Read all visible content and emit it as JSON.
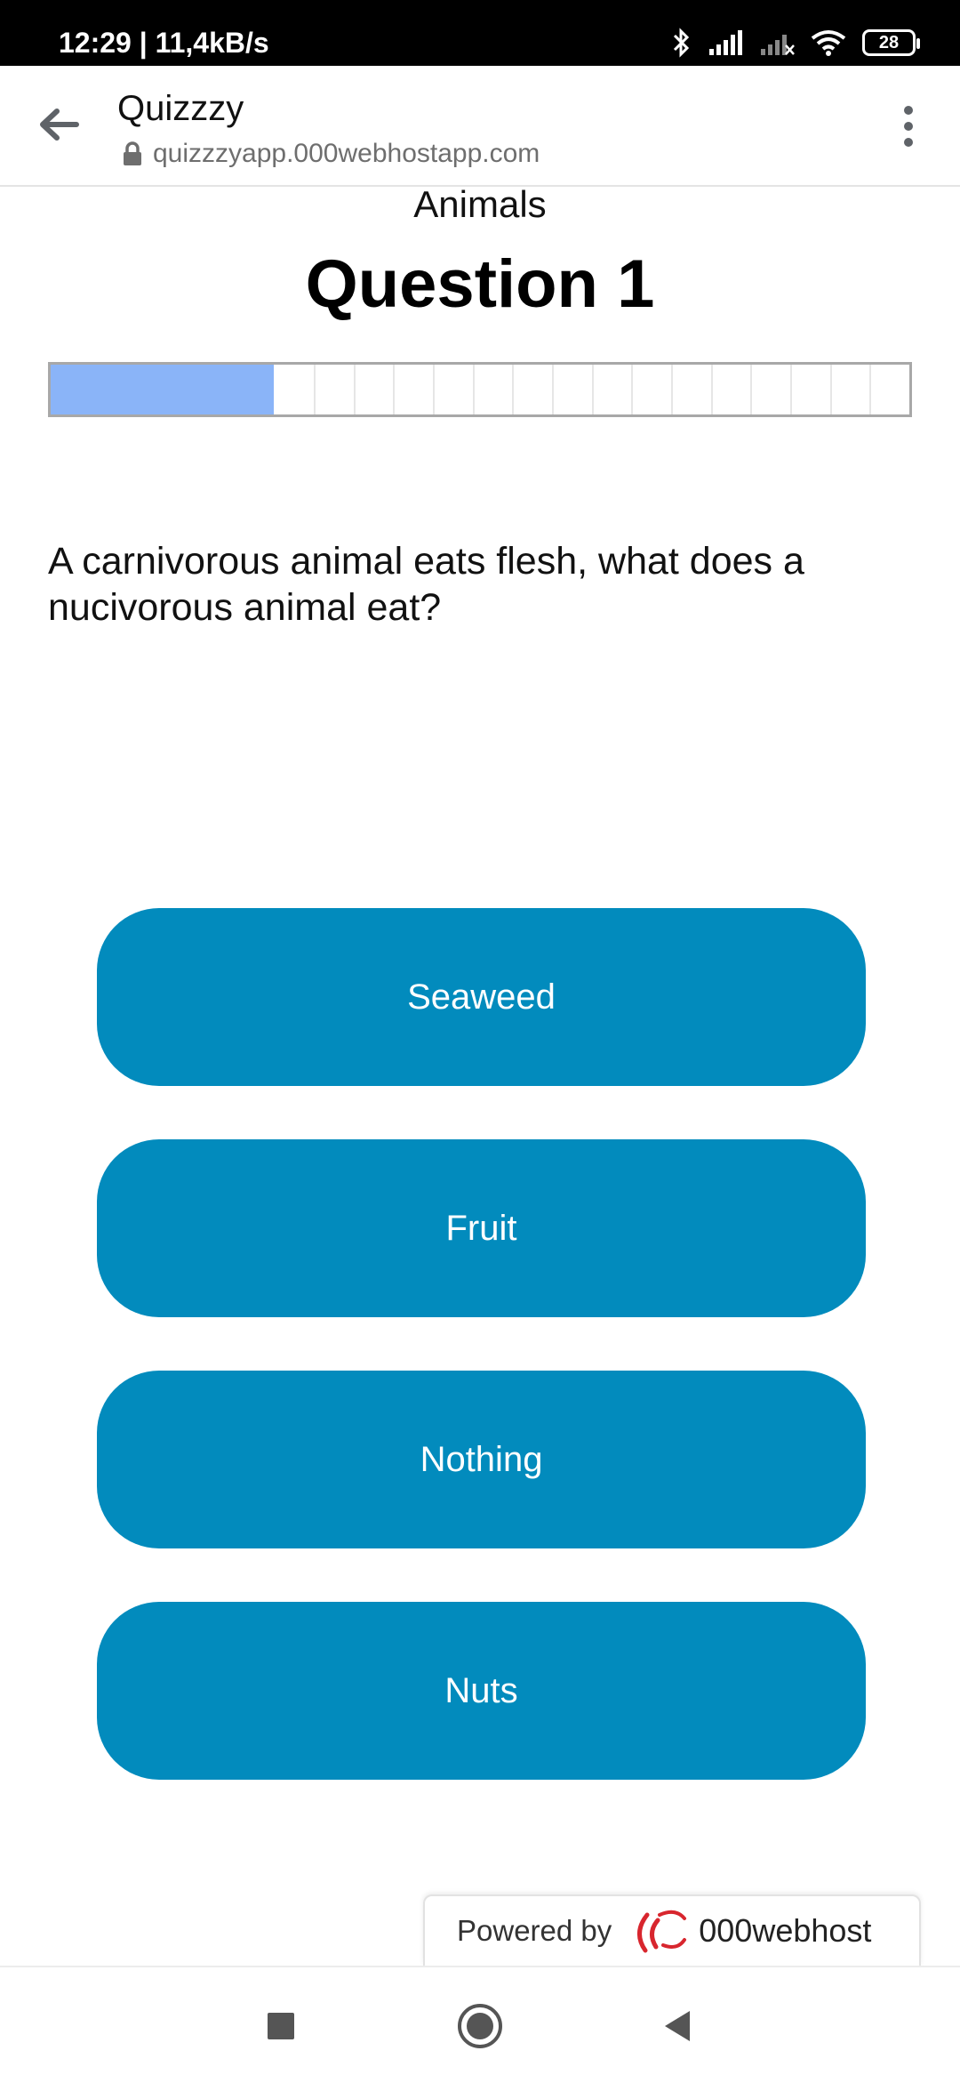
{
  "status_bar": {
    "time": "12:29 | 11,4kB/s",
    "battery": "28"
  },
  "browser": {
    "title": "Quizzzy",
    "url": "quizzzyapp.000webhostapp.com"
  },
  "quiz": {
    "category": "Animals",
    "question_title": "Question 1",
    "progress": {
      "fraction": 0.26,
      "segments": 16
    },
    "question_text": "A carnivorous animal eats flesh, what does a nucivorous animal eat?",
    "answers": [
      "Seaweed",
      "Fruit",
      "Nothing",
      "Nuts"
    ]
  },
  "footer": {
    "powered_by": "Powered by",
    "brand": "000webhost"
  },
  "colors": {
    "answer_bg": "#028bbd",
    "progress_fill": "#8ab4f8"
  }
}
